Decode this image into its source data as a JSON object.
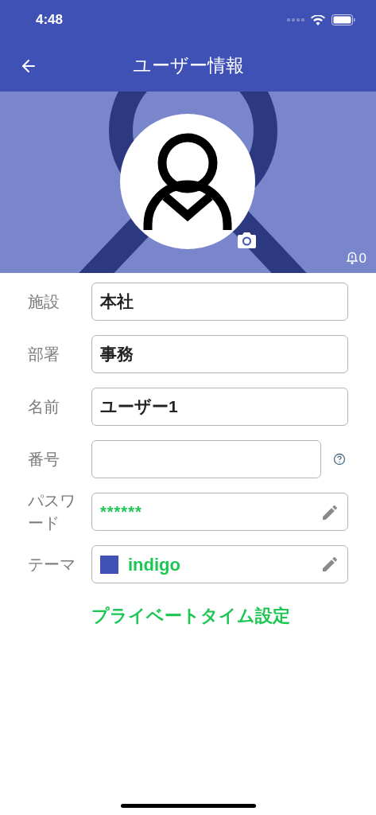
{
  "status_bar": {
    "time": "4:48"
  },
  "app_bar": {
    "title": "ユーザー情報"
  },
  "banner": {
    "notification_count": "0"
  },
  "fields": [
    {
      "kind": "text",
      "label": "施設",
      "value": "本社"
    },
    {
      "kind": "text",
      "label": "部署",
      "value": "事務"
    },
    {
      "kind": "text",
      "label": "名前",
      "value": "ユーザー1"
    },
    {
      "kind": "help",
      "label": "番号"
    },
    {
      "kind": "password",
      "label": "パスワード",
      "value": "******"
    },
    {
      "kind": "theme",
      "label": "テーマ",
      "value": "indigo",
      "color": "#3f51b5"
    }
  ],
  "link": "プライベートタイム設定"
}
